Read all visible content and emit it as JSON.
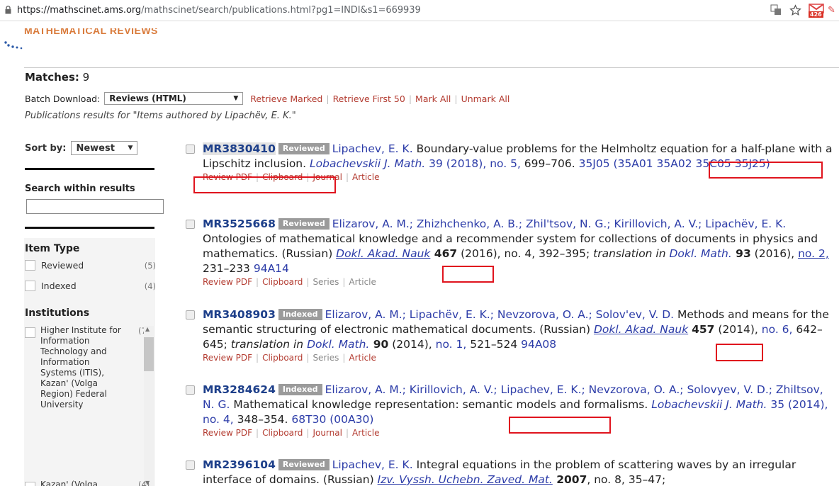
{
  "browser": {
    "url_host": "https://mathscinet.ams.org",
    "url_path": "/mathscinet/search/publications.html?pg1=INDI&s1=669939",
    "mail_badge": "426"
  },
  "header": {
    "logo_text": "MATHEMATICAL REVIEWS",
    "matches_label": "Matches:",
    "matches_count": "9",
    "batch_label": "Batch Download:",
    "batch_select": "Reviews (HTML)",
    "links": [
      "Retrieve Marked",
      "Retrieve First 50",
      "Mark All",
      "Unmark All"
    ],
    "pub_results": "Publications results for \"Items authored by Lipachëv, E. K.\""
  },
  "sidebar": {
    "sort_label": "Sort by:",
    "sort_value": "Newest",
    "search_within": "Search within results",
    "item_type_title": "Item Type",
    "item_types": [
      {
        "label": "Reviewed",
        "count": "(5)"
      },
      {
        "label": "Indexed",
        "count": "(4)"
      }
    ],
    "institutions_title": "Institutions",
    "institutions": [
      {
        "name": "Higher Institute for Information Technology and Information Systems (ITIS), Kazan' (Volga Region) Federal University",
        "count": "(7)"
      },
      {
        "name": "Kazan' (Volga",
        "count": "(4)"
      }
    ]
  },
  "results": [
    {
      "mr": "MR3830410",
      "status": "Reviewed",
      "authors": "Lipachev, E. K.",
      "title": " Boundary-value problems for the Helmholtz equation for a half-plane with a Lipschitz inclusion. ",
      "journal": "Lobachevskii J. Math.",
      "vol": " 39 (2018), no. 5,",
      "pages": " 699–706. ",
      "class": "35J05 (35A01 35A02 35C05 35J25)",
      "actions": [
        "Review PDF",
        "Clipboard",
        "Journal",
        "Article"
      ]
    },
    {
      "mr": "MR3525668",
      "status": "Reviewed",
      "authors": "Elizarov, A. M.; Zhizhchenko, A. B.; Zhil'tsov, N. G.; Kirillovich, A. V.; Lipachëv, E. K.",
      "title": " Ontologies of mathematical knowledge and a recommender system for collections of documents in physics and mathematics. (Russian) ",
      "journal": "Dokl. Akad. Nauk",
      "vol_bold": " 467",
      "vol_rest": " (2016), no. 4, 392–395; ",
      "translation": "translation in",
      "journal2": "Dokl. Math.",
      "vol2_bold": " 93",
      "vol2_rest": " (2016), ",
      "issue2": "no. 2,",
      "pages2": " 231–233 ",
      "class": "94A14",
      "actions": [
        "Review PDF",
        "Clipboard",
        "Series",
        "Article"
      ]
    },
    {
      "mr": "MR3408903",
      "status": "Indexed",
      "authors": "Elizarov, A. M.; Lipachëv, E. K.; Nevzorova, O. A.; Solov'ev, V. D.",
      "title": " Methods and means for the semantic structuring of electronic mathematical documents. (Russian) ",
      "journal": "Dokl. Akad. Nauk",
      "vol_bold": "457",
      "vol_rest": " (2014), ",
      "issue": "no. 6,",
      "pages": " 642–645; ",
      "translation": "translation in",
      "journal2": "Dokl. Math.",
      "vol2_bold": " 90",
      "vol2_rest": " (2014), ",
      "issue2": "no. 1,",
      "pages2": " 521–524 ",
      "class": "94A08",
      "actions": [
        "Review PDF",
        "Clipboard",
        "Series",
        "Article"
      ]
    },
    {
      "mr": "MR3284624",
      "status": "Indexed",
      "authors": "Elizarov, A. M.; Kirillovich, A. V.; Lipachev, E. K.; Nevzorova, O. A.; Solovyev, V. D.; Zhiltsov, N. G.",
      "title": " Mathematical knowledge representation: semantic models and formalisms. ",
      "journal": "Lobachevskii J. Math.",
      "vol": " 35 (2014), no. 4,",
      "pages": " 348–354. ",
      "class": "68T30 (00A30)",
      "actions": [
        "Review PDF",
        "Clipboard",
        "Journal",
        "Article"
      ]
    },
    {
      "mr": "MR2396104",
      "status": "Reviewed",
      "authors": "Lipachev, E. K.",
      "title": " Integral equations in the problem of scattering waves by an irregular interface of domains. (Russian) ",
      "journal": "Izv. Vyssh. Uchebn. Zaved. Mat.",
      "vol_bold": " 2007",
      "vol_rest": ", no. 8, 35–47;"
    }
  ]
}
